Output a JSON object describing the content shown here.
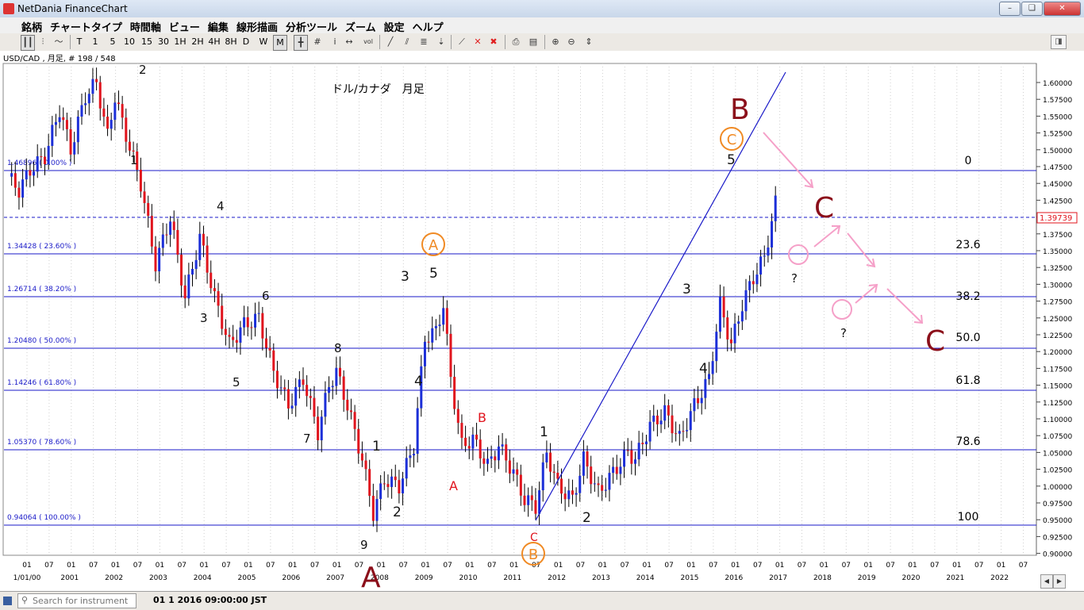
{
  "window": {
    "title": "NetDania FinanceChart",
    "min": "–",
    "restore": "❑",
    "close": "✕"
  },
  "menu": [
    "銘柄",
    "チャートタイプ",
    "時間軸",
    "ビュー",
    "編集",
    "線形描画",
    "分析ツール",
    "ズーム",
    "設定",
    "ヘルプ"
  ],
  "toolbar": {
    "periods": [
      "T",
      "1",
      "5",
      "10",
      "15",
      "30",
      "1H",
      "2H",
      "4H",
      "8H",
      "D",
      "W",
      "M"
    ],
    "selected_period": "M",
    "vol_label": "vol"
  },
  "chart": {
    "symbol_label": "USD/CAD , 月足, # 198 / 548",
    "title": "ドル/カナダ　月足",
    "current_price": "1.39739",
    "y_ticks": [
      "1.60000",
      "1.57500",
      "1.55000",
      "1.52500",
      "1.50000",
      "1.47500",
      "1.45000",
      "1.42500",
      "1.40000",
      "1.37500",
      "1.35000",
      "1.32500",
      "1.30000",
      "1.27500",
      "1.25000",
      "1.22500",
      "1.20000",
      "1.17500",
      "1.15000",
      "1.12500",
      "1.10000",
      "1.07500",
      "1.05000",
      "1.02500",
      "1.00000",
      "0.97500",
      "0.95000",
      "0.92500",
      "0.90000"
    ],
    "x_month_ticks": [
      "01",
      "07",
      "01",
      "07",
      "01",
      "07",
      "01",
      "07",
      "01",
      "07",
      "01",
      "07",
      "01",
      "07",
      "01",
      "07",
      "01",
      "07",
      "01",
      "07",
      "01",
      "07",
      "01",
      "07",
      "01",
      "07",
      "01",
      "07",
      "01",
      "07",
      "01",
      "07",
      "01",
      "07",
      "01",
      "07",
      "01",
      "07",
      "01",
      "07",
      "01",
      "07",
      "01",
      "07",
      "01",
      "07"
    ],
    "x_year_ticks": [
      "1/01/00",
      "2001",
      "2002",
      "2003",
      "2004",
      "2005",
      "2006",
      "2007",
      "2008",
      "2009",
      "2010",
      "2011",
      "2012",
      "2013",
      "2014",
      "2015",
      "2016",
      "2017",
      "2018",
      "2019",
      "2020",
      "2021",
      "2022"
    ],
    "fib_levels": [
      {
        "label": "1.46896 ( 0.00% )",
        "pct": "0"
      },
      {
        "label": "1.34428 ( 23.60% )",
        "pct": "23.6"
      },
      {
        "label": "1.26714 ( 38.20% )",
        "pct": "38.2"
      },
      {
        "label": "1.20480 ( 50.00% )",
        "pct": "50.0"
      },
      {
        "label": "1.14246 ( 61.80% )",
        "pct": "61.8"
      },
      {
        "label": "1.05370 ( 78.60% )",
        "pct": "78.6"
      },
      {
        "label": "0.94064 ( 100.00% )",
        "pct": "100"
      }
    ],
    "wave_labels": {
      "w1": "1",
      "w2": "2",
      "w3": "3",
      "w4": "4",
      "w5": "5",
      "w6": "6",
      "w7": "7",
      "w8": "8",
      "w9": "9",
      "a1": "1",
      "a2": "2",
      "a3": "3",
      "a4": "4",
      "a5": "5",
      "red_a": "A",
      "red_b": "B",
      "red_c": "C",
      "b1": "1",
      "b2": "2",
      "b3": "3",
      "b4": "4",
      "b5": "5",
      "big_a": "A",
      "big_b": "B",
      "big_c1": "C",
      "big_c2": "C",
      "circ_a": "A",
      "circ_b": "B",
      "circ_c": "C",
      "q1": "?",
      "q2": "?"
    }
  },
  "colors": {
    "bull": "#1c2fd8",
    "bear": "#e0141d",
    "fib": "#1a1ac8",
    "crimson": "#8b0f1a",
    "orange": "#f08a24",
    "pink": "#f5a0c8"
  },
  "status": {
    "search_placeholder": "Search for instrument",
    "datetime": "01 1 2016 09:00:00 JST"
  }
}
